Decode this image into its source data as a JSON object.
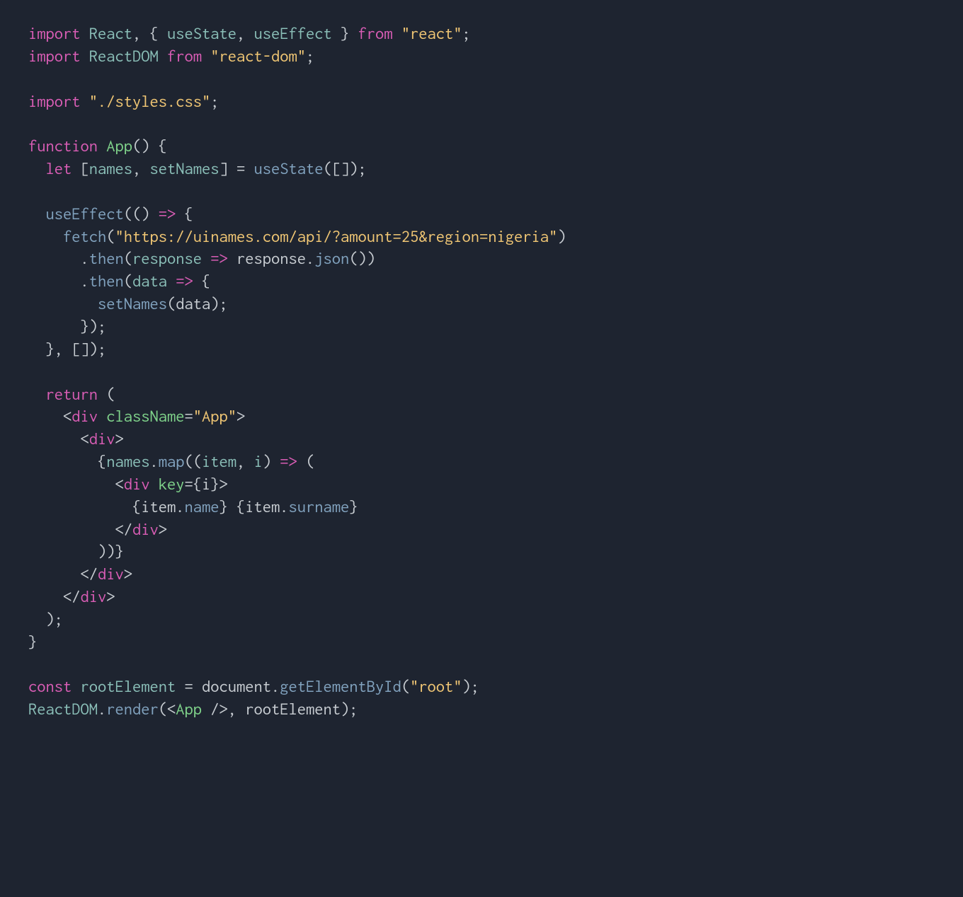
{
  "code": {
    "lines": [
      [
        {
          "t": "import ",
          "c": "kw"
        },
        {
          "t": "React",
          "c": "var"
        },
        {
          "t": ", { ",
          "c": "punct"
        },
        {
          "t": "useState",
          "c": "var"
        },
        {
          "t": ", ",
          "c": "punct"
        },
        {
          "t": "useEffect",
          "c": "var"
        },
        {
          "t": " } ",
          "c": "punct"
        },
        {
          "t": "from ",
          "c": "kw"
        },
        {
          "t": "\"react\"",
          "c": "str"
        },
        {
          "t": ";",
          "c": "punct"
        }
      ],
      [
        {
          "t": "import ",
          "c": "kw"
        },
        {
          "t": "ReactDOM",
          "c": "var"
        },
        {
          "t": " ",
          "c": "punct"
        },
        {
          "t": "from ",
          "c": "kw"
        },
        {
          "t": "\"react-dom\"",
          "c": "str"
        },
        {
          "t": ";",
          "c": "punct"
        }
      ],
      [],
      [
        {
          "t": "import ",
          "c": "kw"
        },
        {
          "t": "\"./styles.css\"",
          "c": "str"
        },
        {
          "t": ";",
          "c": "punct"
        }
      ],
      [],
      [
        {
          "t": "function ",
          "c": "kw"
        },
        {
          "t": "App",
          "c": "fn"
        },
        {
          "t": "() {",
          "c": "punct"
        }
      ],
      [
        {
          "t": "  ",
          "c": "punct"
        },
        {
          "t": "let ",
          "c": "kw"
        },
        {
          "t": "[",
          "c": "punct"
        },
        {
          "t": "names",
          "c": "var"
        },
        {
          "t": ", ",
          "c": "punct"
        },
        {
          "t": "setNames",
          "c": "var"
        },
        {
          "t": "] = ",
          "c": "punct"
        },
        {
          "t": "useState",
          "c": "call"
        },
        {
          "t": "([]);",
          "c": "punct"
        }
      ],
      [],
      [
        {
          "t": "  ",
          "c": "punct"
        },
        {
          "t": "useEffect",
          "c": "call"
        },
        {
          "t": "(() ",
          "c": "punct"
        },
        {
          "t": "=>",
          "c": "arrow"
        },
        {
          "t": " {",
          "c": "punct"
        }
      ],
      [
        {
          "t": "    ",
          "c": "punct"
        },
        {
          "t": "fetch",
          "c": "call"
        },
        {
          "t": "(",
          "c": "punct"
        },
        {
          "t": "\"https://uinames.com/api/?amount=25&region=nigeria\"",
          "c": "str"
        },
        {
          "t": ")",
          "c": "punct"
        }
      ],
      [
        {
          "t": "      .",
          "c": "punct"
        },
        {
          "t": "then",
          "c": "call"
        },
        {
          "t": "(",
          "c": "punct"
        },
        {
          "t": "response",
          "c": "var"
        },
        {
          "t": " ",
          "c": "punct"
        },
        {
          "t": "=>",
          "c": "arrow"
        },
        {
          "t": " ",
          "c": "punct"
        },
        {
          "t": "response",
          "c": "plain"
        },
        {
          "t": ".",
          "c": "punct"
        },
        {
          "t": "json",
          "c": "call"
        },
        {
          "t": "())",
          "c": "punct"
        }
      ],
      [
        {
          "t": "      .",
          "c": "punct"
        },
        {
          "t": "then",
          "c": "call"
        },
        {
          "t": "(",
          "c": "punct"
        },
        {
          "t": "data",
          "c": "var"
        },
        {
          "t": " ",
          "c": "punct"
        },
        {
          "t": "=>",
          "c": "arrow"
        },
        {
          "t": " {",
          "c": "punct"
        }
      ],
      [
        {
          "t": "        ",
          "c": "punct"
        },
        {
          "t": "setNames",
          "c": "call"
        },
        {
          "t": "(",
          "c": "punct"
        },
        {
          "t": "data",
          "c": "plain"
        },
        {
          "t": ");",
          "c": "punct"
        }
      ],
      [
        {
          "t": "      });",
          "c": "punct"
        }
      ],
      [
        {
          "t": "  }, []);",
          "c": "punct"
        }
      ],
      [],
      [
        {
          "t": "  ",
          "c": "punct"
        },
        {
          "t": "return ",
          "c": "kw"
        },
        {
          "t": "(",
          "c": "punct"
        }
      ],
      [
        {
          "t": "    <",
          "c": "punct"
        },
        {
          "t": "div",
          "c": "tag"
        },
        {
          "t": " ",
          "c": "punct"
        },
        {
          "t": "className",
          "c": "fn"
        },
        {
          "t": "=",
          "c": "punct"
        },
        {
          "t": "\"App\"",
          "c": "str"
        },
        {
          "t": ">",
          "c": "punct"
        }
      ],
      [
        {
          "t": "      <",
          "c": "punct"
        },
        {
          "t": "div",
          "c": "tag"
        },
        {
          "t": ">",
          "c": "punct"
        }
      ],
      [
        {
          "t": "        {",
          "c": "punct"
        },
        {
          "t": "names",
          "c": "var"
        },
        {
          "t": ".",
          "c": "punct"
        },
        {
          "t": "map",
          "c": "call"
        },
        {
          "t": "((",
          "c": "punct"
        },
        {
          "t": "item",
          "c": "var"
        },
        {
          "t": ", ",
          "c": "punct"
        },
        {
          "t": "i",
          "c": "var"
        },
        {
          "t": ") ",
          "c": "punct"
        },
        {
          "t": "=>",
          "c": "arrow"
        },
        {
          "t": " (",
          "c": "punct"
        }
      ],
      [
        {
          "t": "          <",
          "c": "punct"
        },
        {
          "t": "div",
          "c": "tag"
        },
        {
          "t": " ",
          "c": "punct"
        },
        {
          "t": "key",
          "c": "fn"
        },
        {
          "t": "={",
          "c": "punct"
        },
        {
          "t": "i",
          "c": "plain"
        },
        {
          "t": "}>",
          "c": "punct"
        }
      ],
      [
        {
          "t": "            {",
          "c": "punct"
        },
        {
          "t": "item",
          "c": "plain"
        },
        {
          "t": ".",
          "c": "punct"
        },
        {
          "t": "name",
          "c": "call"
        },
        {
          "t": "} {",
          "c": "punct"
        },
        {
          "t": "item",
          "c": "plain"
        },
        {
          "t": ".",
          "c": "punct"
        },
        {
          "t": "surname",
          "c": "call"
        },
        {
          "t": "}",
          "c": "punct"
        }
      ],
      [
        {
          "t": "          </",
          "c": "punct"
        },
        {
          "t": "div",
          "c": "tag"
        },
        {
          "t": ">",
          "c": "punct"
        }
      ],
      [
        {
          "t": "        ))}",
          "c": "punct"
        }
      ],
      [
        {
          "t": "      </",
          "c": "punct"
        },
        {
          "t": "div",
          "c": "tag"
        },
        {
          "t": ">",
          "c": "punct"
        }
      ],
      [
        {
          "t": "    </",
          "c": "punct"
        },
        {
          "t": "div",
          "c": "tag"
        },
        {
          "t": ">",
          "c": "punct"
        }
      ],
      [
        {
          "t": "  );",
          "c": "punct"
        }
      ],
      [
        {
          "t": "}",
          "c": "punct"
        }
      ],
      [],
      [
        {
          "t": "const ",
          "c": "kw"
        },
        {
          "t": "rootElement",
          "c": "var"
        },
        {
          "t": " = ",
          "c": "punct"
        },
        {
          "t": "document",
          "c": "plain"
        },
        {
          "t": ".",
          "c": "punct"
        },
        {
          "t": "getElementById",
          "c": "call"
        },
        {
          "t": "(",
          "c": "punct"
        },
        {
          "t": "\"root\"",
          "c": "str"
        },
        {
          "t": ");",
          "c": "punct"
        }
      ],
      [
        {
          "t": "ReactDOM",
          "c": "var"
        },
        {
          "t": ".",
          "c": "punct"
        },
        {
          "t": "render",
          "c": "call"
        },
        {
          "t": "(<",
          "c": "punct"
        },
        {
          "t": "App",
          "c": "fn"
        },
        {
          "t": " />, ",
          "c": "punct"
        },
        {
          "t": "rootElement",
          "c": "plain"
        },
        {
          "t": ");",
          "c": "punct"
        }
      ]
    ]
  }
}
